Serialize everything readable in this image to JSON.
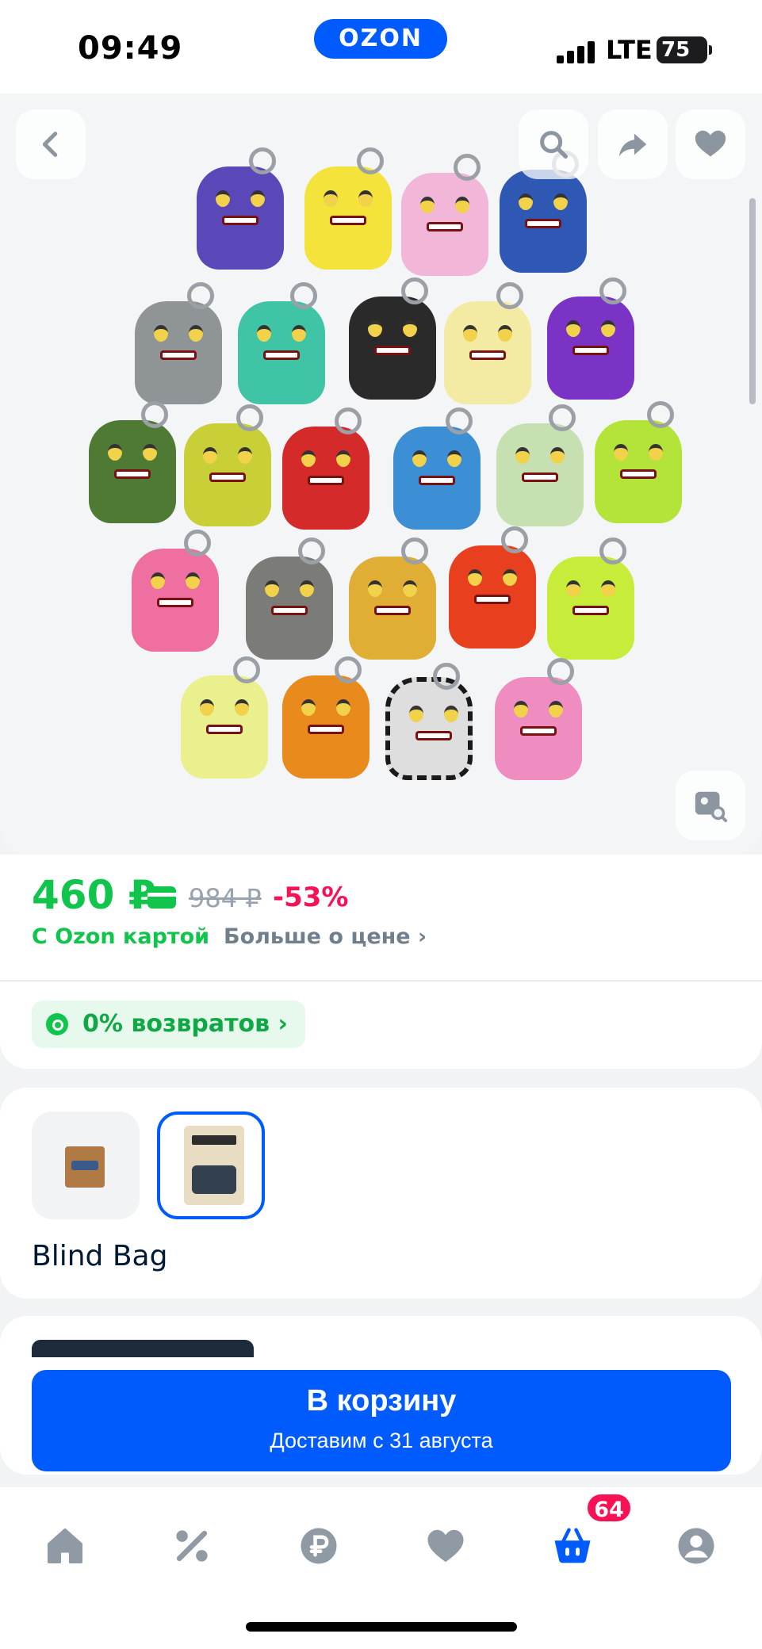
{
  "status_bar": {
    "time": "09:49",
    "network": "LTE",
    "battery": "75"
  },
  "header": {
    "brand": "OZON"
  },
  "gallery": {
    "icons": [
      "back-icon",
      "search-icon",
      "share-icon",
      "heart-icon",
      "image-search-icon"
    ]
  },
  "price": {
    "current": "460 ₽",
    "old": "984 ₽",
    "discount": "-53%",
    "with_card": "С Ozon картой",
    "more_link": "Больше о цене ›"
  },
  "returns": {
    "label": "0% возвратов ›"
  },
  "variants": {
    "selected_label": "Blind Bag",
    "options": [
      "box",
      "blind-bag"
    ]
  },
  "cta": {
    "label": "В корзину",
    "sublabel": "Доставим с 31 августа"
  },
  "tabbar": {
    "items": [
      "home",
      "discounts",
      "payments",
      "favorites",
      "cart",
      "profile"
    ],
    "cart_count": "64"
  },
  "colors": {
    "accent": "#005bff",
    "price_green": "#10c44c",
    "discount_pink": "#f91155"
  }
}
